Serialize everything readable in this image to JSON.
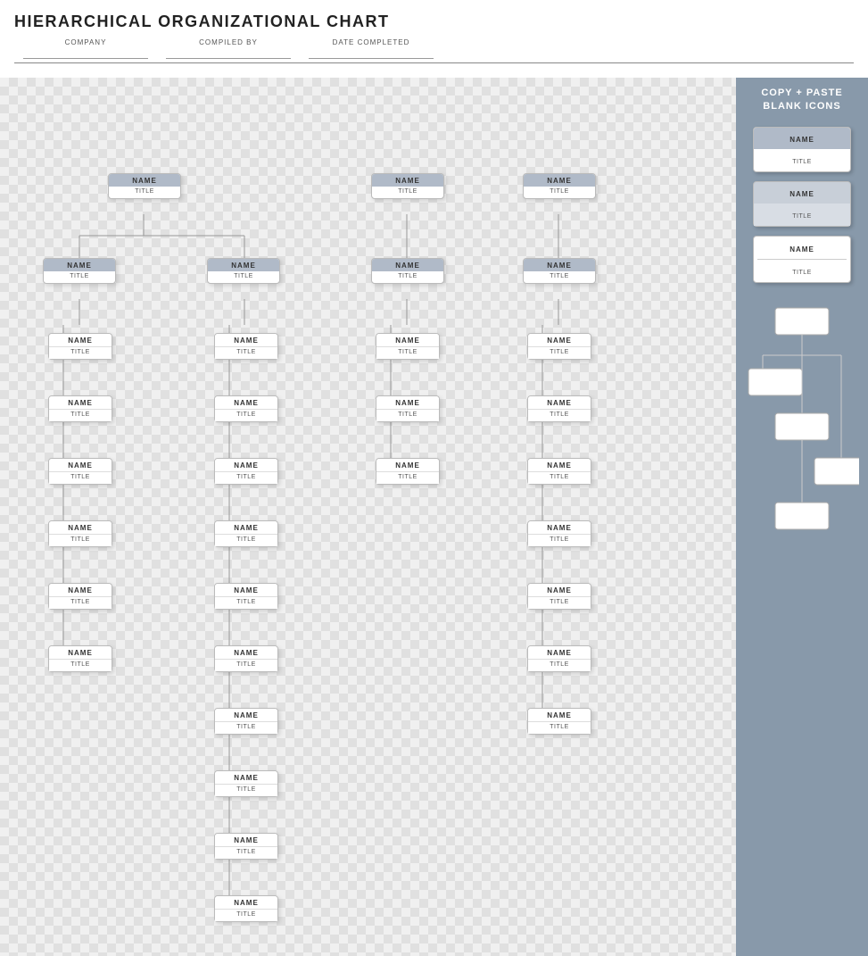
{
  "page": {
    "title": "HIERARCHICAL ORGANIZATIONAL CHART",
    "header": {
      "fields": [
        {
          "label": "COMPANY",
          "value": ""
        },
        {
          "label": "COMPILED BY",
          "value": ""
        },
        {
          "label": "DATE COMPLETED",
          "value": ""
        }
      ]
    },
    "sidebar": {
      "title": "COPY + PASTE\nBLANK ICONS",
      "items": [
        {
          "name": "NAME",
          "title": "TITLE",
          "type": "accent"
        },
        {
          "name": "NAME",
          "title": "TITLE",
          "type": "accent-light"
        },
        {
          "name": "NAME",
          "title": "TITLE",
          "type": "plain"
        }
      ]
    },
    "sections": [
      {
        "id": "s1",
        "level1": {
          "name": "NAME",
          "title": "TITLE"
        },
        "level2": [
          {
            "name": "NAME",
            "title": "TITLE",
            "level3": [
              {
                "name": "NAME",
                "title": "TITLE"
              },
              {
                "name": "NAME",
                "title": "TITLE"
              },
              {
                "name": "NAME",
                "title": "TITLE"
              },
              {
                "name": "NAME",
                "title": "TITLE"
              },
              {
                "name": "NAME",
                "title": "TITLE"
              },
              {
                "name": "NAME",
                "title": "TITLE"
              }
            ]
          },
          {
            "name": "NAME",
            "title": "TITLE",
            "level3": [
              {
                "name": "NAME",
                "title": "TITLE"
              },
              {
                "name": "NAME",
                "title": "TITLE"
              },
              {
                "name": "NAME",
                "title": "TITLE"
              },
              {
                "name": "NAME",
                "title": "TITLE"
              },
              {
                "name": "NAME",
                "title": "TITLE"
              },
              {
                "name": "NAME",
                "title": "TITLE"
              },
              {
                "name": "NAME",
                "title": "TITLE"
              },
              {
                "name": "NAME",
                "title": "TITLE"
              },
              {
                "name": "NAME",
                "title": "TITLE"
              },
              {
                "name": "NAME",
                "title": "TITLE"
              }
            ]
          }
        ]
      },
      {
        "id": "s2",
        "level1": {
          "name": "NAME",
          "title": "TITLE"
        },
        "level2": [
          {
            "name": "NAME",
            "title": "TITLE",
            "level3": [
              {
                "name": "NAME",
                "title": "TITLE"
              },
              {
                "name": "NAME",
                "title": "TITLE"
              },
              {
                "name": "NAME",
                "title": "TITLE"
              }
            ]
          }
        ]
      },
      {
        "id": "s3",
        "level1": {
          "name": "NAME",
          "title": "TITLE"
        },
        "level2": [
          {
            "name": "NAME",
            "title": "TITLE",
            "level3": [
              {
                "name": "NAME",
                "title": "TITLE"
              },
              {
                "name": "NAME",
                "title": "TITLE"
              },
              {
                "name": "NAME",
                "title": "TITLE"
              },
              {
                "name": "NAME",
                "title": "TITLE"
              },
              {
                "name": "NAME",
                "title": "TITLE"
              },
              {
                "name": "NAME",
                "title": "TITLE"
              },
              {
                "name": "NAME",
                "title": "TITLE"
              }
            ]
          }
        ]
      }
    ]
  }
}
